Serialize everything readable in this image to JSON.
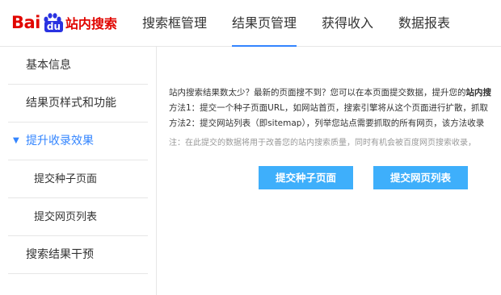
{
  "brand": {
    "logo_bai": "Bai",
    "logo_du": "du",
    "logo_suffix": "站内搜索"
  },
  "nav": [
    {
      "label": "搜索框管理"
    },
    {
      "label": "结果页管理"
    },
    {
      "label": "获得收入"
    },
    {
      "label": "数据报表"
    }
  ],
  "sidebar": {
    "items": [
      {
        "label": "基本信息"
      },
      {
        "label": "结果页样式和功能"
      },
      {
        "label": "提升收录效果"
      },
      {
        "label": "提交种子页面"
      },
      {
        "label": "提交网页列表"
      },
      {
        "label": "搜索结果干预"
      }
    ]
  },
  "main": {
    "intro_plain": "站内搜索结果数太少？最新的页面搜不到？您可以在本页面提交数据，提升您的",
    "intro_bold": "站内搜",
    "method1": "方法1：提交一个种子页面URL，如网站首页，搜索引擎将从这个页面进行扩散，抓取",
    "method2": "方法2：提交网站列表（即sitemap），列举您站点需要抓取的所有网页，该方法收录",
    "note": "注：在此提交的数据将用于改善您的站内搜索质量，同时有机会被百度网页搜索收录，",
    "btn_seed": "提交种子页面",
    "btn_list": "提交网页列表"
  },
  "colors": {
    "brand_red": "#e10601",
    "brand_blue": "#2932e1",
    "accent": "#3385ff",
    "button": "#3eaffb"
  }
}
